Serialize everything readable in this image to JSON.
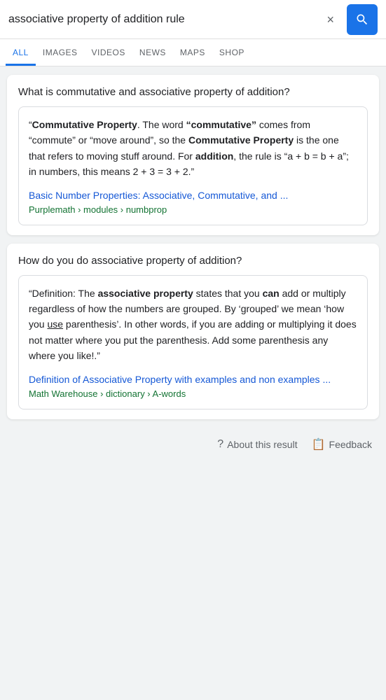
{
  "search": {
    "query": "associative property of addition rule",
    "clear_label": "×",
    "search_icon": "🔍"
  },
  "tabs": [
    {
      "label": "ALL",
      "active": true
    },
    {
      "label": "IMAGES",
      "active": false
    },
    {
      "label": "VIDEOS",
      "active": false
    },
    {
      "label": "NEWS",
      "active": false
    },
    {
      "label": "MAPS",
      "active": false
    },
    {
      "label": "SHOP",
      "active": false
    }
  ],
  "cards": [
    {
      "question": "What is commutative and associative property of addition?",
      "answer_text_html": "“<strong>Commutative Property</strong>. The word <strong>“commutative”</strong> comes from “commute” or “move around”, so the <strong>Commutative Property</strong> is the one that refers to moving stuff around. For <strong>addition</strong>, the rule is “a + b = b + a”; in numbers, this means 2 + 3 = 3 + 2.”",
      "link_text": "Basic Number Properties: Associative, Commutative, and ...",
      "source_text": "Purplemath › modules › numbprop"
    },
    {
      "question": "How do you do associative property of addition?",
      "answer_text_html": "“Definition: The <strong>associative property</strong> states that you <strong>can</strong> add or multiply regardless of how the numbers are grouped. By ‘grouped’ we mean ‘how you <u>use</u> parenthesis’. In other words, if you are adding or multiplying it does not matter where you put the parenthesis. Add some parenthesis any where you like!.”",
      "link_text": "Definition of Associative Property with examples and non examples ...",
      "source_text": "Math Warehouse › dictionary › A-words"
    }
  ],
  "footer": {
    "about_label": "About this result",
    "feedback_label": "Feedback"
  }
}
